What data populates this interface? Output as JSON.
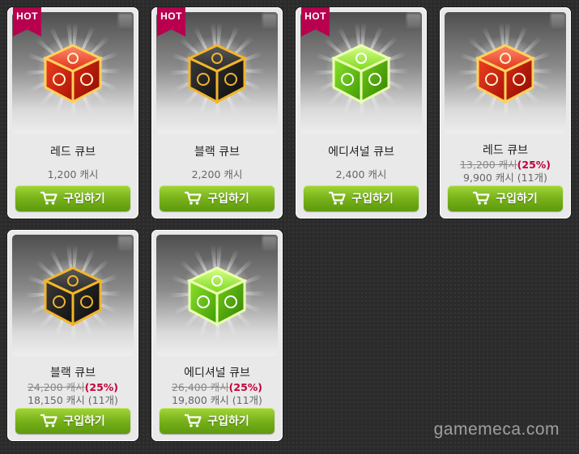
{
  "shop": {
    "items": [
      {
        "name": "레드 큐브",
        "price": "1,200 캐시",
        "hot": "HOT",
        "buy_label": "구입하기",
        "cube": "red-cube"
      },
      {
        "name": "블랙 큐브",
        "price": "2,200 캐시",
        "hot": "HOT",
        "buy_label": "구입하기",
        "cube": "black-cube"
      },
      {
        "name": "에디셔널 큐브",
        "price": "2,400 캐시",
        "hot": "HOT",
        "buy_label": "구입하기",
        "cube": "green-cube"
      },
      {
        "name": "레드 큐브",
        "old_price": "13,200 캐시",
        "discount": "(25%)",
        "bundle_price": "9,900 캐시 (11개)",
        "buy_label": "구입하기",
        "cube": "red-cube"
      },
      {
        "name": "블랙 큐브",
        "old_price": "24,200 캐시",
        "discount": "(25%)",
        "bundle_price": "18,150 캐시 (11개)",
        "buy_label": "구입하기",
        "cube": "black-cube"
      },
      {
        "name": "에디셔널 큐브",
        "old_price": "26,400 캐시",
        "discount": "(25%)",
        "bundle_price": "19,800 캐시 (11개)",
        "buy_label": "구입하기",
        "cube": "green-cube"
      }
    ]
  },
  "watermark": "gamemeca.com",
  "colors": {
    "hot_badge": "#b8004f",
    "buy_button": "#78b21a",
    "discount_text": "#c2003c",
    "background": "#2b2b2b"
  }
}
